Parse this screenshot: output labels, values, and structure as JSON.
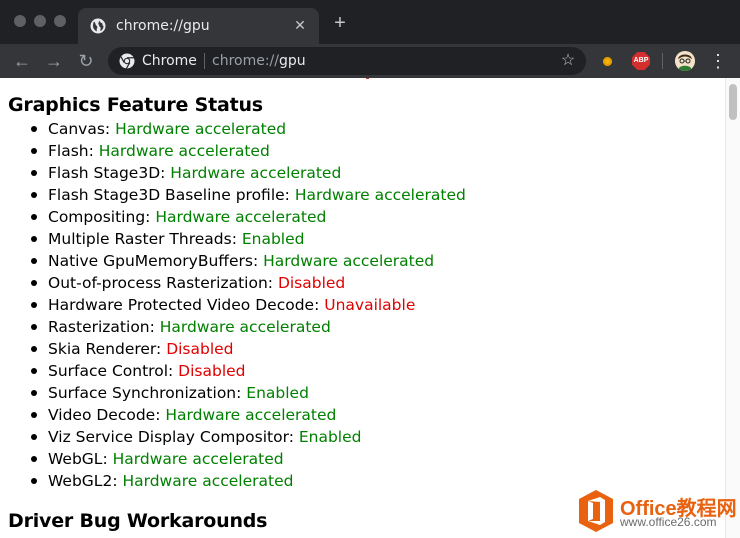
{
  "browser": {
    "tab_title": "chrome://gpu",
    "tab_close": "✕",
    "new_tab": "+",
    "nav": {
      "back": "←",
      "forward": "→",
      "reload": "↻"
    },
    "omnibox": {
      "chip_label": "Chrome",
      "url_scheme": "chrome://",
      "url_host": "gpu"
    },
    "bookmark_icon": "star-icon",
    "extensions": [
      "extension-dot-icon",
      "adblock-plus-icon"
    ],
    "adblock_label": "ABP",
    "menu_glyph": "⋮"
  },
  "page": {
    "section_title": "Graphics Feature Status",
    "features": [
      {
        "name": "Canvas",
        "status": "Hardware accelerated",
        "state": "green"
      },
      {
        "name": "Flash",
        "status": "Hardware accelerated",
        "state": "green"
      },
      {
        "name": "Flash Stage3D",
        "status": "Hardware accelerated",
        "state": "green"
      },
      {
        "name": "Flash Stage3D Baseline profile",
        "status": "Hardware accelerated",
        "state": "green"
      },
      {
        "name": "Compositing",
        "status": "Hardware accelerated",
        "state": "green"
      },
      {
        "name": "Multiple Raster Threads",
        "status": "Enabled",
        "state": "green"
      },
      {
        "name": "Native GpuMemoryBuffers",
        "status": "Hardware accelerated",
        "state": "green"
      },
      {
        "name": "Out-of-process Rasterization",
        "status": "Disabled",
        "state": "red"
      },
      {
        "name": "Hardware Protected Video Decode",
        "status": "Unavailable",
        "state": "red"
      },
      {
        "name": "Rasterization",
        "status": "Hardware accelerated",
        "state": "green"
      },
      {
        "name": "Skia Renderer",
        "status": "Disabled",
        "state": "red"
      },
      {
        "name": "Surface Control",
        "status": "Disabled",
        "state": "red"
      },
      {
        "name": "Surface Synchronization",
        "status": "Enabled",
        "state": "green"
      },
      {
        "name": "Video Decode",
        "status": "Hardware accelerated",
        "state": "green"
      },
      {
        "name": "Viz Service Display Compositor",
        "status": "Enabled",
        "state": "green"
      },
      {
        "name": "WebGL",
        "status": "Hardware accelerated",
        "state": "green"
      },
      {
        "name": "WebGL2",
        "status": "Hardware accelerated",
        "state": "green"
      }
    ],
    "next_section_title": "Driver Bug Workarounds"
  },
  "colors": {
    "status_green": "#008000",
    "status_red": "#e00000",
    "chrome_dark": "#202124",
    "toolbar": "#35363a"
  },
  "watermark": {
    "name": "Office教程网",
    "url": "www.office26.com"
  }
}
